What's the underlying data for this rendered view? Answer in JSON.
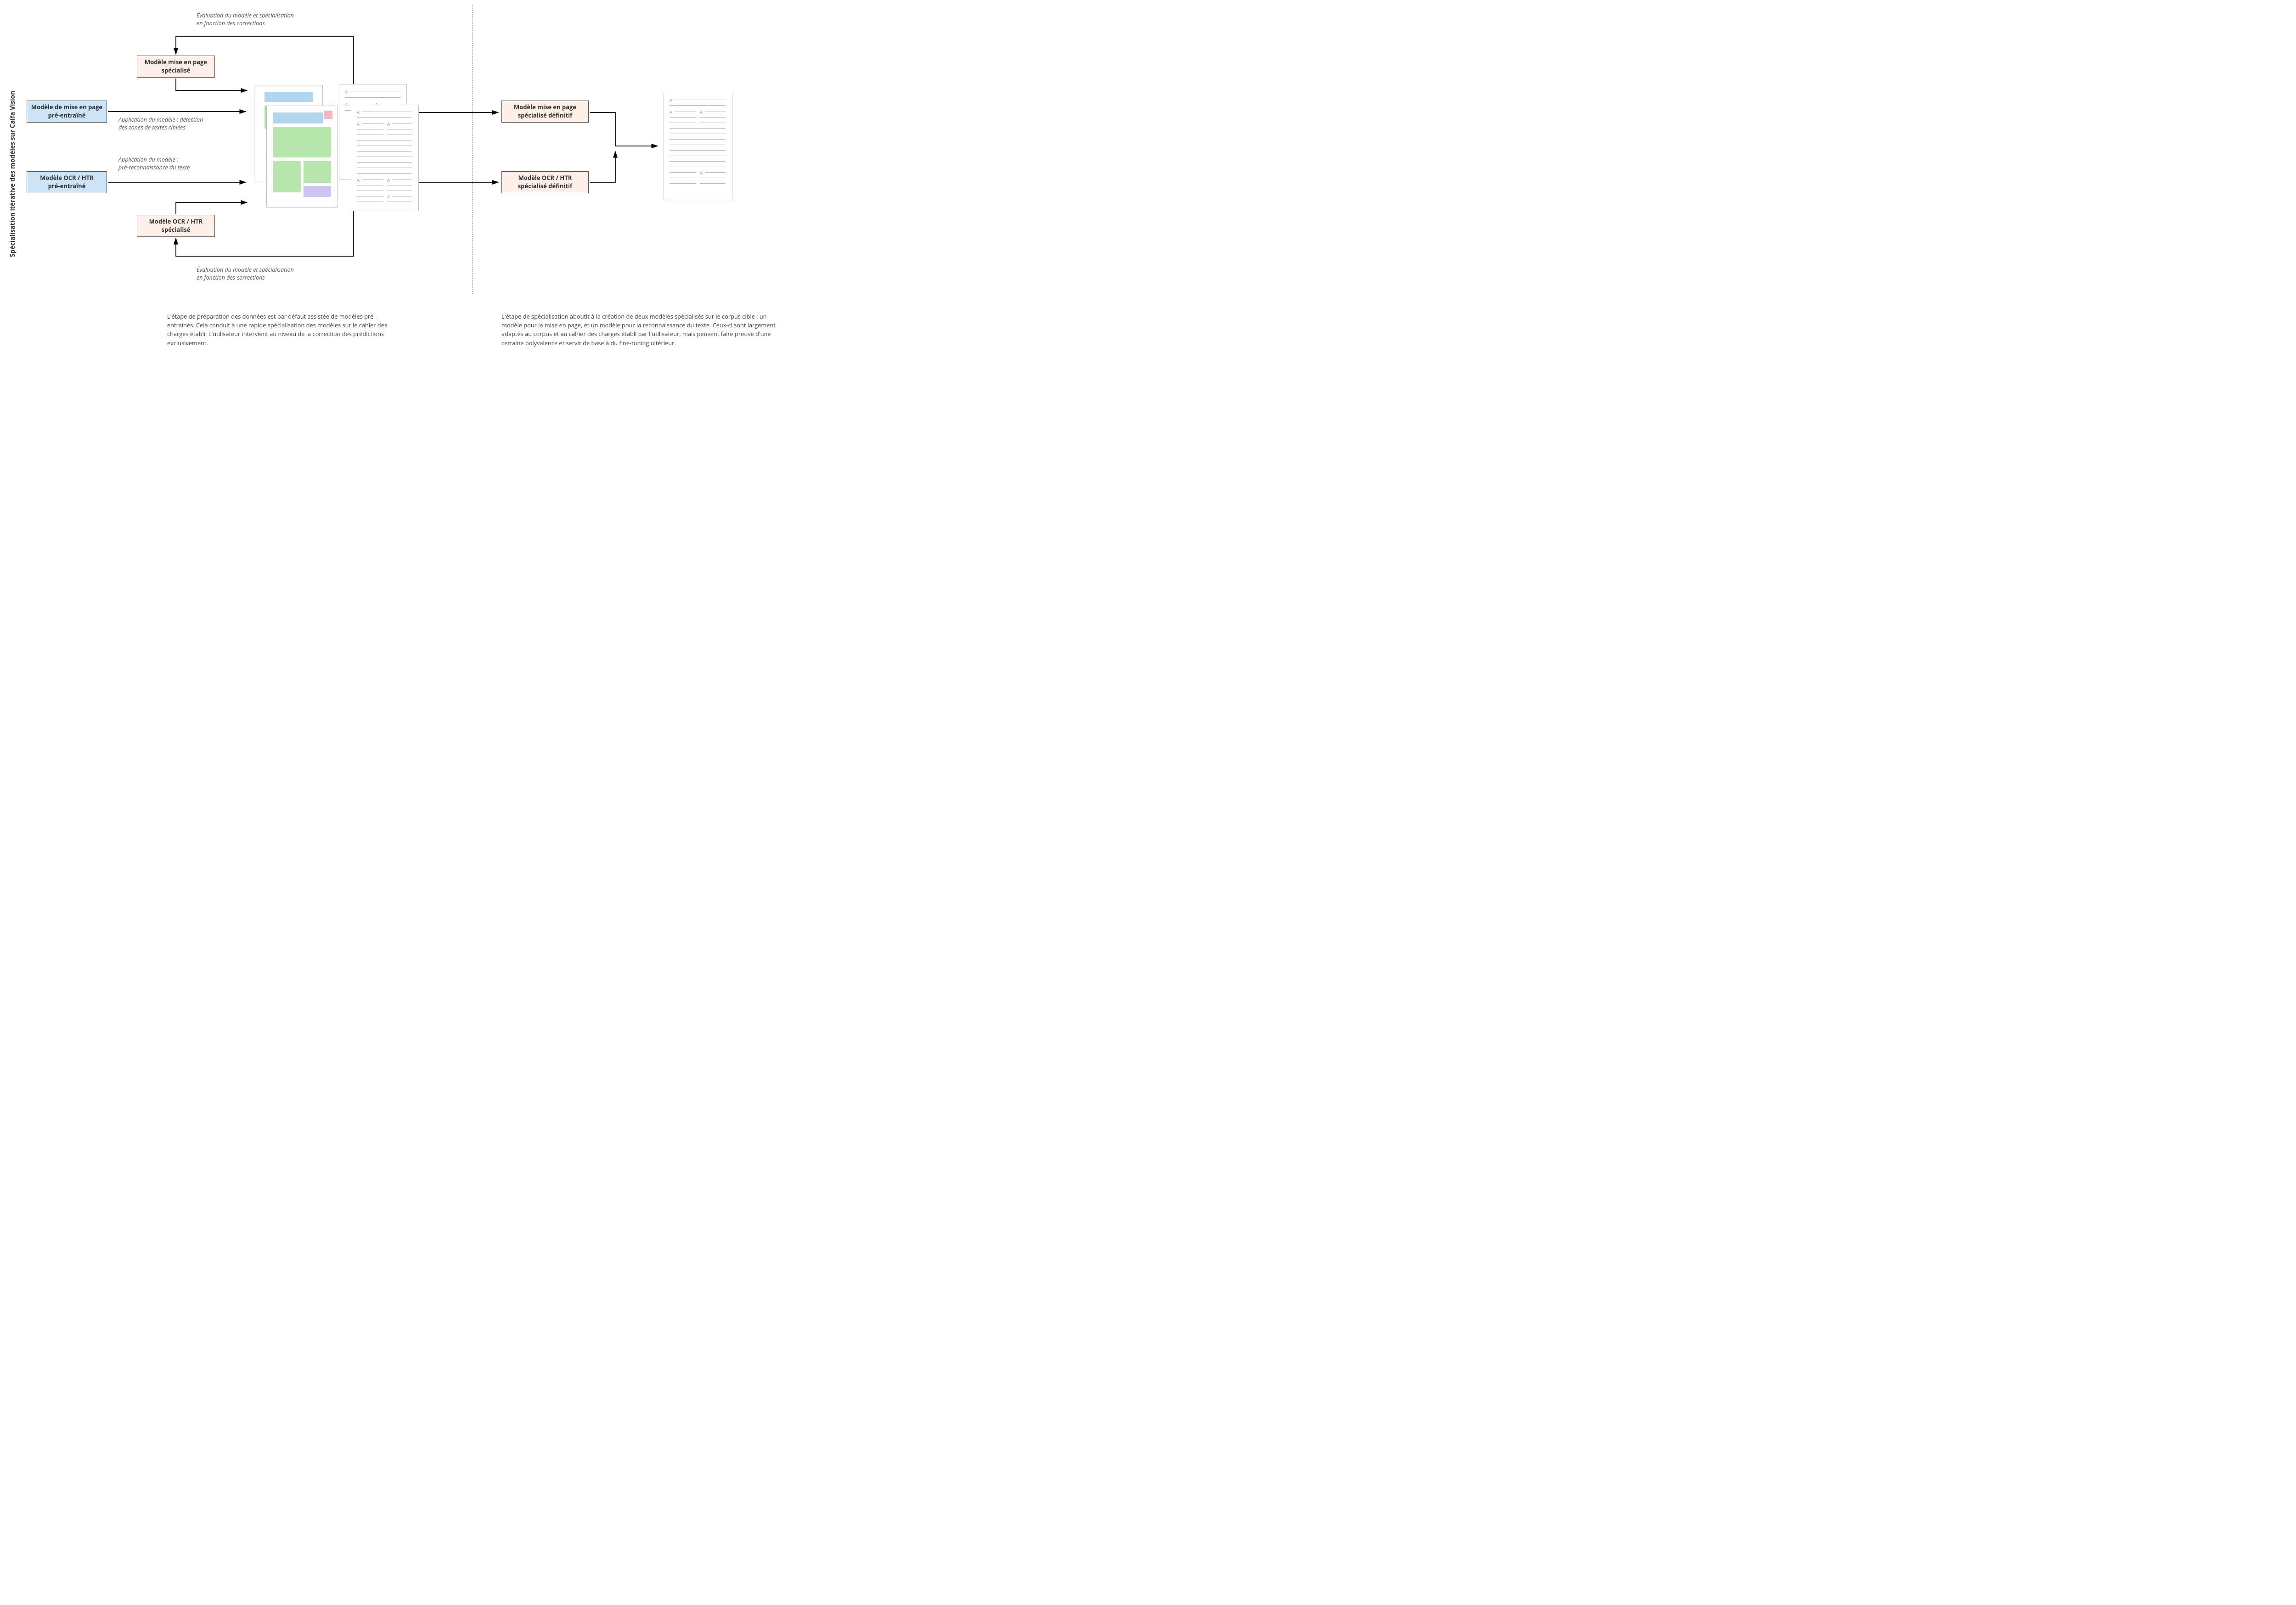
{
  "title": "Spécialisation itérative des modèles sur Calfa Vision",
  "boxes": {
    "layout_pre": "Modèle de mise en page\npré-entraîné",
    "ocr_pre": "Modèle OCR / HTR\npré-entraîné",
    "layout_spec": "Modèle mise en page\nspécialisé",
    "ocr_spec": "Modèle OCR / HTR\nspécialisé",
    "layout_final": "Modèle mise en page\nspécialisé définitif",
    "ocr_final": "Modèle OCR / HTR\nspécialisé définitif"
  },
  "captions": {
    "eval_top": "Évaluation du modèle et spécialisation\nen fonction des corrections",
    "eval_bottom": "Évaluation du modèle et spécialisation\nen fonction des corrections",
    "apply_layout": "Application du modèle : détection\ndes zones de textes ciblées",
    "apply_ocr": "Application du modèle :\npré-reconnaissance du texte"
  },
  "paragraphs": {
    "left": "L'étape de préparation des données est par défaut assistée de modèles pré-entraînés. Cela conduit à une rapide spécialisation des modèles sur le cahier des charges établi. L'utilisateur intervient au niveau de la correction des prédictions exclusivement.",
    "right": "L'étape de spécialisation aboutit à la création de deux modèles spécialisés sur le corpus cible : un modèle pour la mise en page, et un modèle pour la reconnaissance du texte. Ceux-ci sont largement adaptés au corpus et au cahier des charges établi par l'utilisateur, mais peuvent faire preuve d'une certaine polyvalence et servir de base à du fine-tuning ultérieur."
  }
}
